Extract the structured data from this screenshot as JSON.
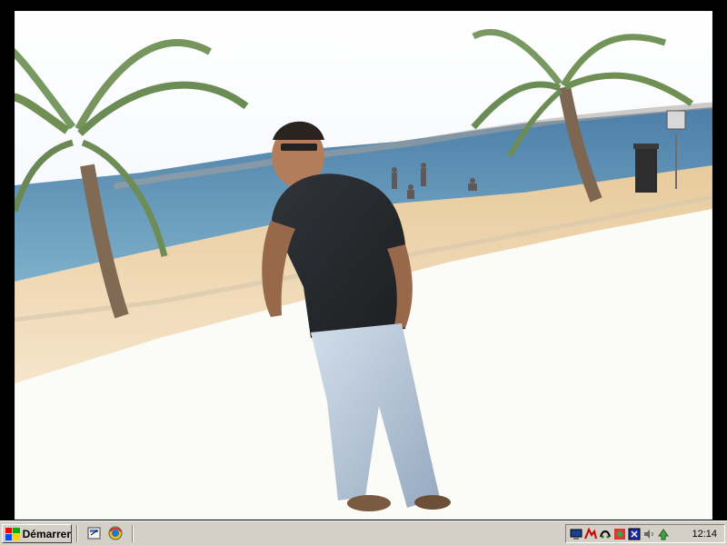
{
  "taskbar": {
    "start_label": "Démarrer",
    "clock": "12:14"
  },
  "quick_launch": [
    {
      "icon": "show-desktop-icon"
    },
    {
      "icon": "browser-icon"
    }
  ],
  "tray_icons": [
    {
      "icon": "monitor-icon"
    },
    {
      "icon": "network-icon"
    },
    {
      "icon": "modem-icon"
    },
    {
      "icon": "antivirus-icon"
    },
    {
      "icon": "display-icon"
    },
    {
      "icon": "volume-icon"
    },
    {
      "icon": "update-icon"
    }
  ],
  "colors": {
    "taskbar": "#d4d0c8",
    "sky": "#f4f7fb",
    "sea": "#4d8eb7",
    "sand": "#e9d4ae"
  }
}
